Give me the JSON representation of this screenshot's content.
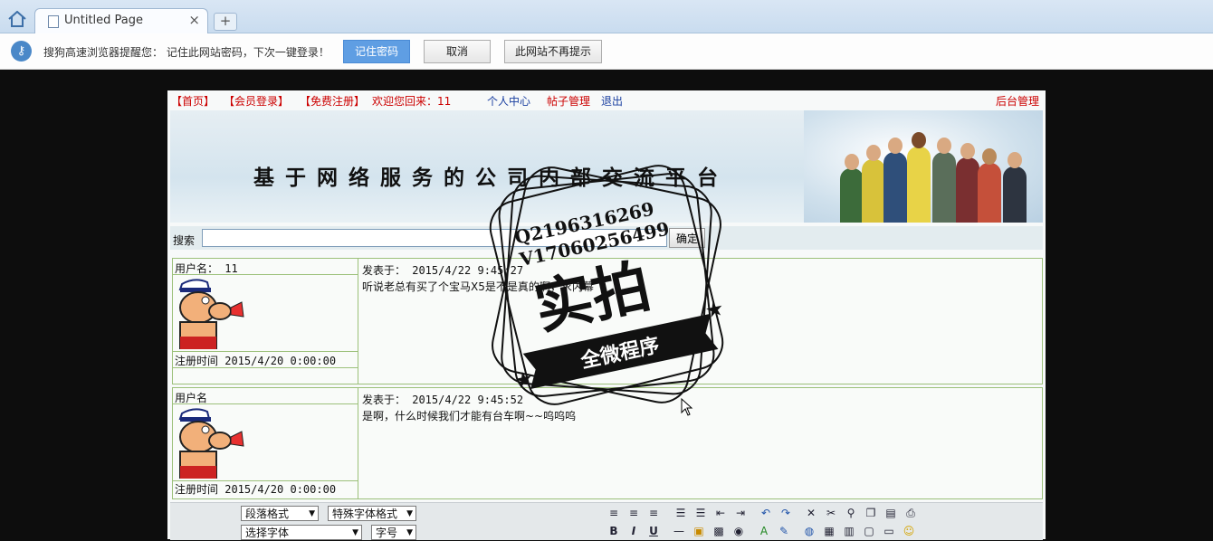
{
  "browser": {
    "tab_title": "Untitled Page",
    "tab_close": "×",
    "new_tab": "+",
    "notify_text": "搜狗高速浏览器提醒您：  记住此网站密码，下次一键登录！",
    "btn_remember": "记住密码",
    "btn_cancel": "取消",
    "btn_never": "此网站不再提示"
  },
  "nav": {
    "home": "【首页】",
    "login": "【会员登录】",
    "register": "【免费注册】",
    "welcome": "欢迎您回来：11",
    "personal": "个人中心",
    "posts": "帖子管理",
    "logout": "退出",
    "admin": "后台管理"
  },
  "banner": {
    "title": "基于网络服务的公司内部交流平台"
  },
  "search": {
    "label": "搜索",
    "value": "",
    "button": "确定"
  },
  "posts": [
    {
      "username": "用户名： 11",
      "reg_time": "注册时间 2015/4/20 0:00:00",
      "post_time": "发表于： 2015/4/22 9:45:27",
      "content": "听说老总有买了个宝马X5是不是真的啊，求内幕"
    },
    {
      "username": "用户名",
      "reg_time": "注册时间 2015/4/20 0:00:00",
      "post_time": "发表于： 2015/4/22 9:45:52",
      "content": "是啊，什么时候我们才能有台车啊~~呜呜呜"
    }
  ],
  "editor": {
    "paragraph_format": "段落格式",
    "special_format": "特殊字体格式",
    "font_select": "选择字体",
    "font_size": "字号"
  },
  "watermark": {
    "line1": "Q2196316269",
    "line2": "V17060256499",
    "main": "实拍",
    "ribbon": "全微程序"
  }
}
